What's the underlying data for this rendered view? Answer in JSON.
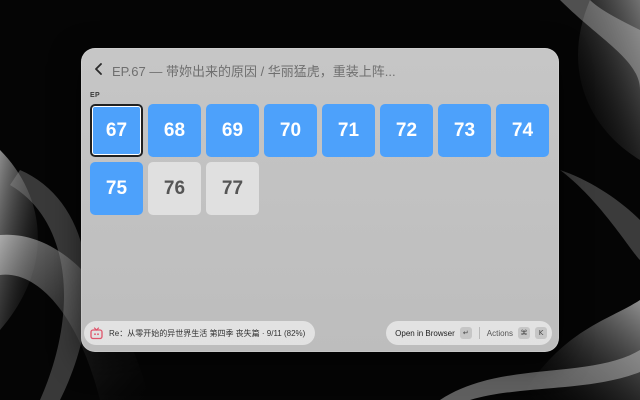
{
  "colors": {
    "watched": "#4da1fb",
    "unwatched": "#e0e0e0",
    "anime_icon": "#e0546b"
  },
  "header": {
    "back_icon": "chevron-left-icon",
    "title": "EP.67 — 带妳出来的原因 / 华丽猛虎，重装上阵..."
  },
  "episodes": {
    "section_label": "EP",
    "selected": "67",
    "items": [
      {
        "number": "67",
        "status": "watched"
      },
      {
        "number": "68",
        "status": "watched"
      },
      {
        "number": "69",
        "status": "watched"
      },
      {
        "number": "70",
        "status": "watched"
      },
      {
        "number": "71",
        "status": "watched"
      },
      {
        "number": "72",
        "status": "watched"
      },
      {
        "number": "73",
        "status": "watched"
      },
      {
        "number": "74",
        "status": "watched"
      },
      {
        "number": "75",
        "status": "watched"
      },
      {
        "number": "76",
        "status": "unwatched"
      },
      {
        "number": "77",
        "status": "unwatched"
      }
    ]
  },
  "footer": {
    "now_playing_icon": "tv-icon",
    "now_playing": "Re：从零开始的异世界生活 第四季 丧失篇 · 9/11 (82%)",
    "open_label": "Open in Browser",
    "enter_key": "↵",
    "actions_label": "Actions",
    "cmd_key": "⌘",
    "k_key": "K"
  }
}
